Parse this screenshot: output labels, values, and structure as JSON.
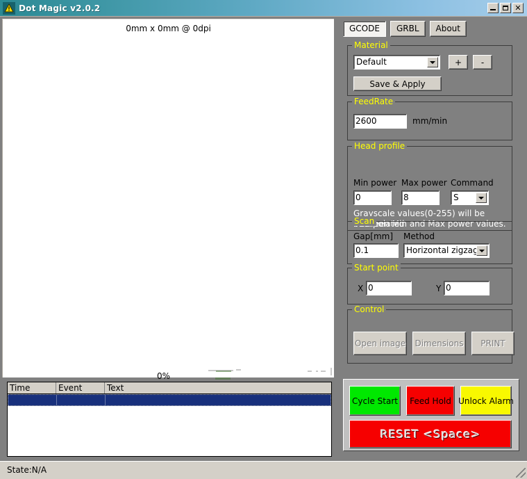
{
  "window": {
    "title": "Dot Magic v2.0.2",
    "icon": "warning-triangle-icon",
    "minimize_label": "_",
    "maximize_label": "□",
    "close_label": "×",
    "accent_title_start": "#2b8994",
    "accent_title_end": "#a6cdea"
  },
  "canvas": {
    "caption": "0mm x 0mm @ 0dpi",
    "progress_label": "0%"
  },
  "log": {
    "columns": [
      "Time",
      "Event",
      "Text"
    ],
    "rows": [
      {
        "time": "",
        "event": "",
        "text": ""
      }
    ]
  },
  "tabs": [
    {
      "label": "GCODE",
      "active": true
    },
    {
      "label": "GRBL",
      "active": false
    },
    {
      "label": "About",
      "active": false
    }
  ],
  "material": {
    "group_label": "Material",
    "selected": "Default",
    "add_label": "+",
    "remove_label": "-",
    "save_label": "Save & Apply"
  },
  "feedrate": {
    "group_label": "FeedRate",
    "value": "2600",
    "unit": "mm/min"
  },
  "head_profile": {
    "group_label": "Head profile",
    "min_power_label": "Min power",
    "min_power_value": "0",
    "max_power_label": "Max power",
    "max_power_value": "8",
    "command_label": "Command",
    "command_value": "S",
    "help_line1": "Grayscale values(0-255) will be interpolated",
    "help_line2": "between Min and Max power values."
  },
  "scan": {
    "group_label": "Scan",
    "gap_label": "Gap[mm]",
    "gap_value": "0.1",
    "method_label": "Method",
    "method_value": "Horizontal zigzag"
  },
  "start_point": {
    "group_label": "Start point",
    "x_label": "X",
    "x_value": "0",
    "y_label": "Y",
    "y_value": "0"
  },
  "control": {
    "group_label": "Control",
    "open_image_label": "Open image",
    "dimensions_label": "Dimensions",
    "print_label": "PRINT"
  },
  "machine_controls": {
    "cycle_start": {
      "label": "Cycle Start",
      "color": "#00e800"
    },
    "feed_hold": {
      "label": "Feed Hold",
      "color": "#f60000"
    },
    "unlock_alarm": {
      "label": "Unlock Alarm",
      "color": "#f8f800"
    },
    "reset": {
      "label": "RESET <Space>",
      "color": "#f60000"
    }
  },
  "statusbar": {
    "text": "State:N/A"
  }
}
